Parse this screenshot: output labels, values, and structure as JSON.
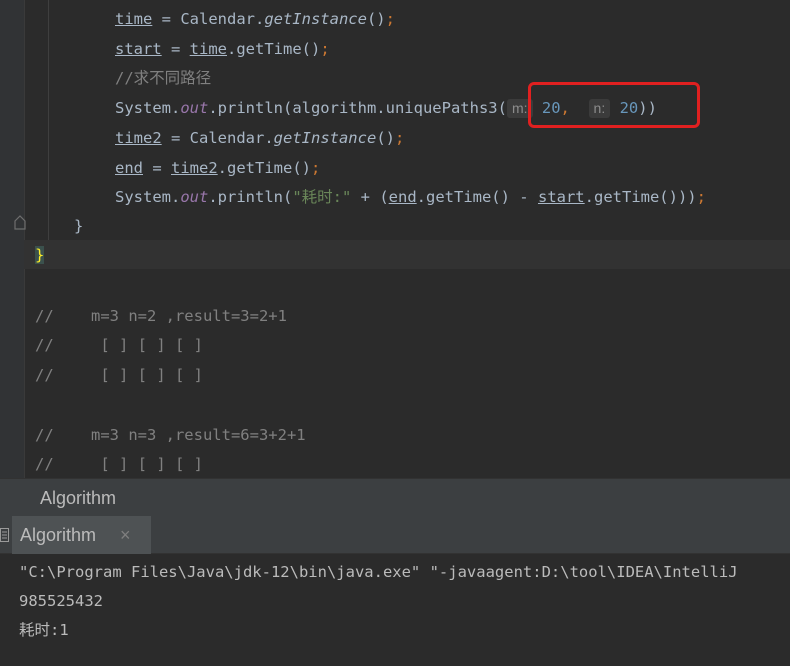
{
  "editor": {
    "l1": {
      "v": "time",
      "op": " = Calendar.",
      "m": "getInstance",
      "p": "()",
      "s": ";"
    },
    "l2": {
      "v": "start",
      "op": " = ",
      "v2": "time",
      "m": ".getTime()",
      "s": ";"
    },
    "l3": {
      "c": "//求不同路径"
    },
    "l4": {
      "a": "System.",
      "out": "out",
      "b": ".println(algorithm.uniquePaths3(",
      "h1": "m:",
      "n1": "20",
      "comma": ",",
      "h2": "n:",
      "n2": "20",
      "end": "))"
    },
    "l5": {
      "v": "time2",
      "op": " = Calendar.",
      "m": "getInstance",
      "p": "()",
      "s": ";"
    },
    "l6": {
      "v": "end",
      "op": " = ",
      "v2": "time2",
      "m": ".getTime()",
      "s": ";"
    },
    "l7": {
      "a": "System.",
      "out": "out",
      "b": ".println(",
      "str": "\"耗时:\"",
      "c": " + (",
      "v": "end",
      "d": ".getTime() - ",
      "v2": "start",
      "e": ".getTime()))",
      "s": ";"
    },
    "l8": "}",
    "l9": "}",
    "comments": [
      "//    m=3 n=2 ,result=3=2+1",
      "//     [ ] [ ] [ ]",
      "//     [ ] [ ] [ ]",
      "//    m=3 n=3 ,result=6=3+2+1",
      "//     [ ] [ ] [ ]"
    ]
  },
  "breadcrumb": {
    "label": "Algorithm"
  },
  "run": {
    "tab_label": "Algorithm",
    "close": "×"
  },
  "console": {
    "lines": [
      "\"C:\\Program Files\\Java\\jdk-12\\bin\\java.exe\" \"-javaagent:D:\\tool\\IDEA\\IntelliJ",
      "985525432",
      "耗时:1"
    ]
  },
  "colors": {
    "background": "#2b2b2b",
    "highlight_box": "#e02020",
    "panel": "#3c3f41"
  }
}
